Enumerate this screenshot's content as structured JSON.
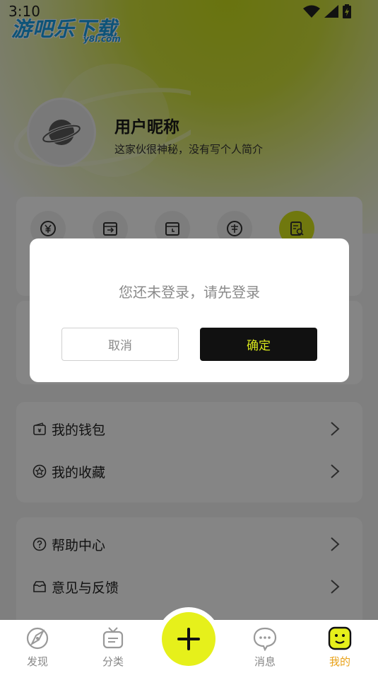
{
  "status_bar": {
    "time": "3:10"
  },
  "watermark": {
    "text": "游吧乐下载",
    "sub": "y8l.com"
  },
  "profile": {
    "nickname": "用户昵称",
    "bio": "这家伙很神秘，没有写个人简介"
  },
  "quick_actions": [
    {
      "icon": "yuan-coin-icon"
    },
    {
      "icon": "export-box-icon"
    },
    {
      "icon": "clock-box-icon"
    },
    {
      "icon": "sale-tag-icon"
    },
    {
      "icon": "search-document-icon"
    }
  ],
  "menu_group_1": [
    {
      "label": "我的钱包",
      "icon": "wallet-icon"
    },
    {
      "label": "我的收藏",
      "icon": "star-badge-icon"
    }
  ],
  "menu_group_2": [
    {
      "label": "帮助中心",
      "icon": "help-icon"
    },
    {
      "label": "意见与反馈",
      "icon": "feedback-icon"
    }
  ],
  "dialog": {
    "message": "您还未登录，请先登录",
    "cancel": "取消",
    "confirm": "确定"
  },
  "tabbar": {
    "discover": "发现",
    "category": "分类",
    "messages": "消息",
    "mine": "我的"
  },
  "colors": {
    "accent": "#d7e61c",
    "fab": "#e6f01b",
    "active_tab": "#e8a21a"
  }
}
